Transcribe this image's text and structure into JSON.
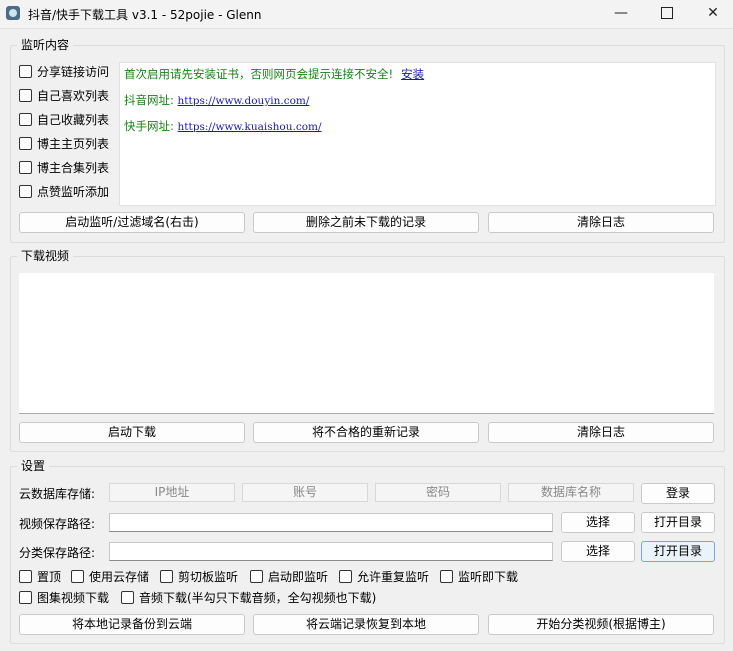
{
  "window": {
    "title": "抖音/快手下载工具 v3.1 - 52pojie - Glenn",
    "minimize": "—",
    "close": "✕"
  },
  "monitor": {
    "title": "监听内容",
    "checkboxes": [
      "分享链接访问",
      "自己喜欢列表",
      "自己收藏列表",
      "博主主页列表",
      "博主合集列表",
      "点赞监听添加"
    ],
    "log": {
      "line1": "首次启用请先安装证书，否则网页会提示连接不安全!",
      "install_link": "安装",
      "douyin_label": "抖音网址:",
      "douyin_url": "https://www.douyin.com/",
      "kuaishou_label": "快手网址:",
      "kuaishou_url": "https://www.kuaishou.com/"
    },
    "buttons": [
      "启动监听/过滤域名(右击)",
      "删除之前未下载的记录",
      "清除日志"
    ]
  },
  "download": {
    "title": "下载视频",
    "buttons": [
      "启动下载",
      "将不合格的重新记录",
      "清除日志"
    ]
  },
  "settings": {
    "title": "设置",
    "cloud_label": "云数据库存储:",
    "cloud_fields": [
      "IP地址",
      "账号",
      "密码",
      "数据库名称"
    ],
    "login_button": "登录",
    "video_path_label": "视频保存路径:",
    "category_path_label": "分类保存路径:",
    "select_button": "选择",
    "open_dir_button": "打开目录",
    "options_row1": [
      "置顶",
      "使用云存储",
      "剪切板监听",
      "启动即监听",
      "允许重复监听",
      "监听即下载"
    ],
    "options_row2": [
      "图集视频下载",
      "音频下载(半勾只下载音频，全勾视频也下载)"
    ],
    "bottom_buttons": [
      "将本地记录备份到云端",
      "将云端记录恢复到本地",
      "开始分类视频(根据博主)"
    ]
  }
}
